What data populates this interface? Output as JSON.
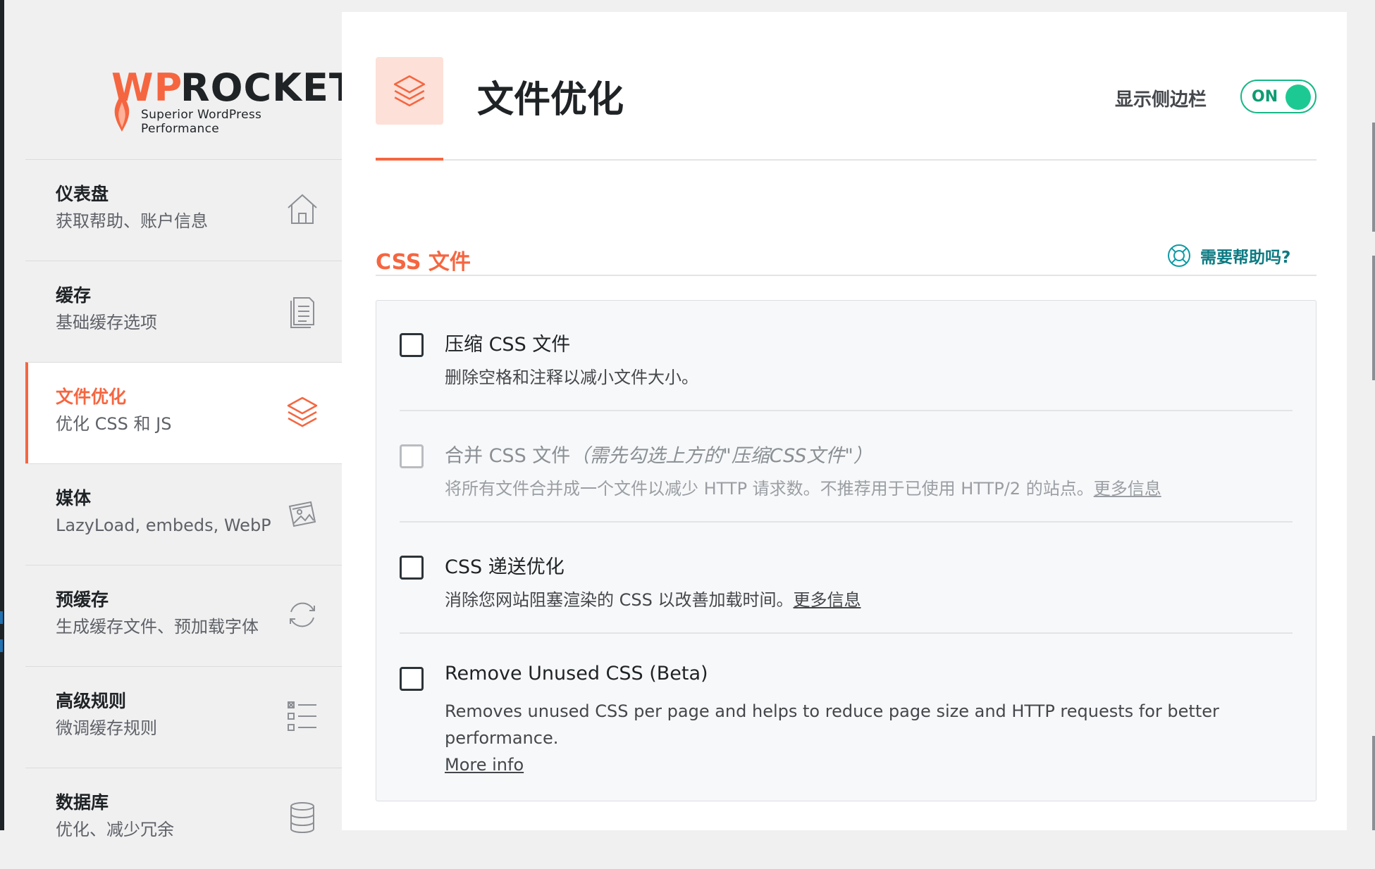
{
  "brand": {
    "wp": "WP",
    "rocket": "ROCKET",
    "tagline": "Superior WordPress Performance"
  },
  "nav": {
    "items": [
      {
        "title": "仪表盘",
        "desc": "获取帮助、账户信息",
        "icon": "home-icon"
      },
      {
        "title": "缓存",
        "desc": "基础缓存选项",
        "icon": "document-icon"
      },
      {
        "title": "文件优化",
        "desc": "优化 CSS 和 JS",
        "icon": "layers-icon",
        "active": true
      },
      {
        "title": "媒体",
        "desc": "LazyLoad, embeds, WebP",
        "icon": "images-icon"
      },
      {
        "title": "预缓存",
        "desc": "生成缓存文件、预加载字体",
        "icon": "refresh-icon"
      },
      {
        "title": "高级规则",
        "desc": "微调缓存规则",
        "icon": "checklist-icon"
      },
      {
        "title": "数据库",
        "desc": "优化、减少冗余",
        "icon": "database-icon"
      }
    ]
  },
  "header": {
    "title": "文件优化",
    "sidebar_toggle_label": "显示侧边栏",
    "sidebar_toggle_state": "ON",
    "accent_color": "#f56640",
    "toggle_color": "#1dc992"
  },
  "section": {
    "title": "CSS 文件",
    "help_label": "需要帮助吗?"
  },
  "options": [
    {
      "label": "压缩 CSS 文件",
      "desc": "删除空格和注释以减小文件大小。",
      "checked": false
    },
    {
      "label": "合并 CSS 文件",
      "note": "（需先勾选上方的\"压缩CSS文件\"）",
      "desc": "将所有文件合并成一个文件以减少 HTTP 请求数。不推荐用于已使用 HTTP/2 的站点。",
      "more": "更多信息",
      "checked": false,
      "disabled": true
    },
    {
      "label": "CSS 递送优化",
      "desc": "消除您网站阻塞渲染的 CSS 以改善加载时间。",
      "more": "更多信息",
      "checked": false
    },
    {
      "label": "Remove Unused CSS (Beta)",
      "desc": "Removes unused CSS per page and helps to reduce page size and HTTP requests for better performance.",
      "more": "More info",
      "checked": false
    }
  ]
}
